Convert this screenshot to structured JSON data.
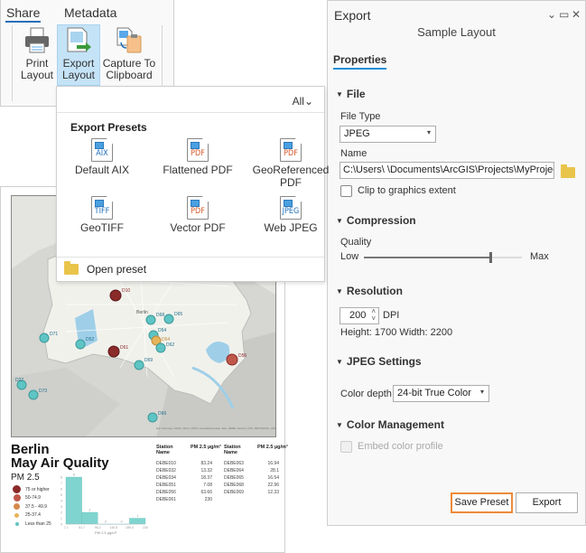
{
  "ribbon": {
    "tabs": [
      {
        "label": "Share",
        "active": true
      },
      {
        "label": "Metadata",
        "active": false
      }
    ],
    "buttons": [
      {
        "icon": "printer-icon",
        "line1": "Print",
        "line2": "Layout"
      },
      {
        "icon": "export-layout-icon",
        "line1": "Export",
        "line2": "Layout",
        "dropdown": "⌄"
      },
      {
        "icon": "clipboard-icon",
        "line1": "Capture To",
        "line2": "Clipboard"
      }
    ]
  },
  "dropdown": {
    "filter": "All",
    "filter_chevron": "⌄",
    "title": "Export Presets",
    "presets": [
      {
        "label": "Default AIX",
        "format": "AIX"
      },
      {
        "label": "Flattened PDF",
        "format": "PDF"
      },
      {
        "label": "GeoReferenced PDF",
        "format": "PDF"
      },
      {
        "label": "GeoTIFF",
        "format": "TIFF"
      },
      {
        "label": "Vector PDF",
        "format": "PDF"
      },
      {
        "label": "Web JPEG",
        "format": "JPEG"
      }
    ],
    "open_preset": "Open preset"
  },
  "layout": {
    "title_line1": "Berlin",
    "title_line2": "May Air Quality",
    "legend_title": "PM 2.5",
    "legend": [
      {
        "label": "75 or higher",
        "color": "#8b2a2a"
      },
      {
        "label": "50-74.9",
        "color": "#c0584a"
      },
      {
        "label": "37.5 - 49.9",
        "color": "#d68a4a"
      },
      {
        "label": "25-37.4",
        "color": "#e6b45a"
      },
      {
        "label": "Less than 25",
        "color": "#5fc4c4"
      }
    ],
    "map_labels": [
      "D10",
      "D68",
      "D65",
      "D54",
      "D64",
      "D62",
      "D61",
      "D52",
      "D71",
      "D69",
      "D56",
      "D27",
      "D73",
      "D66",
      "Berlin"
    ],
    "map_credit": "Esri Intermap, NASA, NGA, USGS, Geodatastyrelsen, Esri, HERE, Garmin, FAO, METI/NASA, USGS",
    "table": {
      "headers": [
        "Station Name",
        "PM 2.5 µg/m³",
        "Station Name",
        "PM 2.5 µg/m³"
      ],
      "left": [
        {
          "station": "DEBE010",
          "value": "83.24"
        },
        {
          "station": "DEBE032",
          "value": "13.32"
        },
        {
          "station": "DEBE034",
          "value": "18.37"
        },
        {
          "station": "DEBE051",
          "value": "7.08"
        },
        {
          "station": "DEBE056",
          "value": "63.66"
        },
        {
          "station": "DEBE061",
          "value": "230"
        }
      ],
      "right": [
        {
          "station": "DEBE063",
          "value": "16.94"
        },
        {
          "station": "DEBE064",
          "value": "28.1"
        },
        {
          "station": "DEBE065",
          "value": "16.54"
        },
        {
          "station": "DEBE068",
          "value": "22.96"
        },
        {
          "station": "DEBE069",
          "value": "12.33"
        }
      ]
    }
  },
  "chart_data": {
    "type": "bar",
    "title": "",
    "xlabel": "PM 2.5 µg/m³",
    "ylabel": "",
    "categories": [
      "7.1-51.7",
      "51.7-96.2",
      "96.2-140.8",
      "140.8-185.4",
      "185.4-230"
    ],
    "bin_edges": [
      "7.1",
      "51.7",
      "96.2",
      "140.8",
      "185.4",
      "230"
    ],
    "values": [
      8,
      2,
      0,
      0,
      1
    ],
    "ylim": [
      0,
      8
    ],
    "yticks": [
      0,
      1,
      2,
      3,
      4,
      5,
      6,
      7,
      8
    ],
    "color": "#7fd4cf"
  },
  "pane": {
    "title": "Export",
    "controls": [
      "⌄",
      "▭",
      "✕"
    ],
    "subtitle": "Sample Layout",
    "tab": "Properties",
    "sections": {
      "file": "File",
      "compression": "Compression",
      "resolution": "Resolution",
      "jpeg": "JPEG Settings",
      "color": "Color Management"
    },
    "file_type_label": "File Type",
    "file_type_value": "JPEG",
    "name_label": "Name",
    "name_value": "C:\\Users\\        \\Documents\\ArcGIS\\Projects\\MyProject",
    "clip_label": "Clip to graphics extent",
    "clip_checked": false,
    "quality_label": "Quality",
    "quality_low": "Low",
    "quality_max": "Max",
    "quality_value": 0.8,
    "dpi_value": "200",
    "dpi_unit": "DPI",
    "size_text": "Height: 1700 Width: 2200",
    "color_depth_label": "Color depth",
    "color_depth_value": "24-bit True Color",
    "embed_label": "Embed color profile",
    "embed_checked": false,
    "embed_enabled": false,
    "save_preset": "Save Preset",
    "export": "Export",
    "accent": "#1f8fd6",
    "highlight": "#ee8a3a"
  }
}
